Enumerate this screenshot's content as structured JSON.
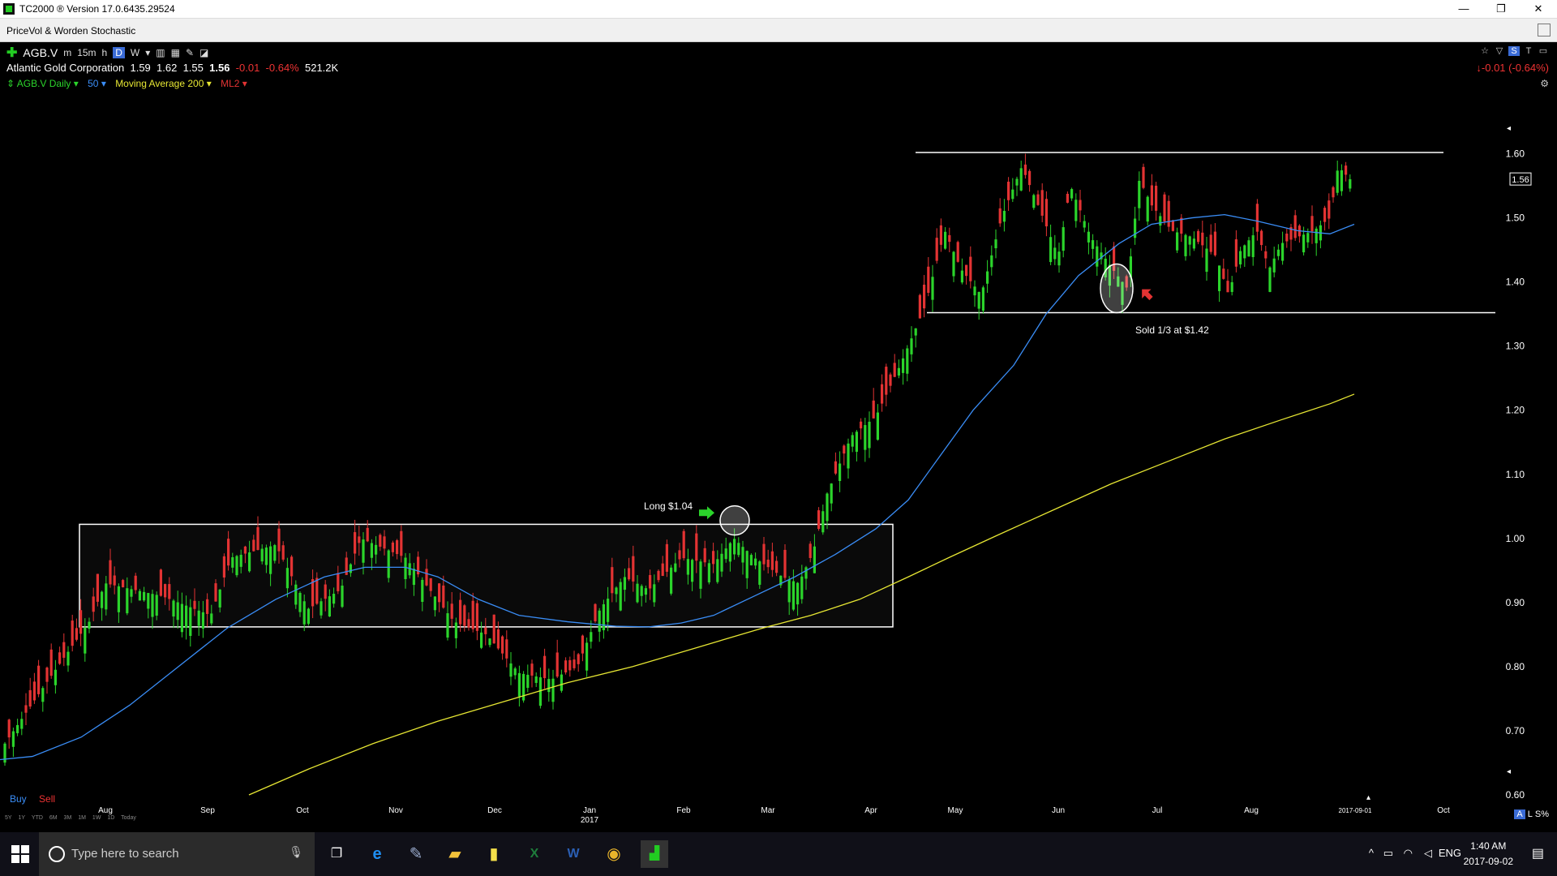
{
  "window": {
    "title": "TC2000 ® Version 17.0.6435.29524",
    "minimize": "—",
    "restore": "❐",
    "close": "✕"
  },
  "subwindow": {
    "title": "PriceVol & Worden Stochastic"
  },
  "header": {
    "symbol": "AGB.V",
    "timeframes": [
      "m",
      "15m",
      "h",
      "D",
      "W"
    ],
    "selected_timeframe": "D",
    "company": "Atlantic Gold Corporation",
    "open": "1.59",
    "high": "1.62",
    "low": "1.55",
    "close": "1.56",
    "change": "-0.01",
    "change_pct": "-0.64%",
    "volume": "521.2K",
    "right_change": "-0.01 (-0.64%)",
    "indicators": [
      {
        "label": "AGB.V Daily",
        "color": "#2bd42b"
      },
      {
        "label": "50",
        "color": "#3a8df6"
      },
      {
        "label": "Moving Average 200",
        "color": "#e6e633"
      },
      {
        "label": "ML2",
        "color": "#e33333"
      }
    ]
  },
  "chart_data": {
    "type": "candlestick",
    "symbol": "AGB.V",
    "y_ticks": [
      "1.60",
      "1.50",
      "1.40",
      "1.30",
      "1.20",
      "1.10",
      "1.00",
      "0.90",
      "0.80",
      "0.70",
      "0.60"
    ],
    "ylim": [
      0.6,
      1.65
    ],
    "x_ticks": [
      "Aug",
      "Sep",
      "Oct",
      "Nov",
      "Dec",
      "Jan",
      "Feb",
      "Mar",
      "Apr",
      "May",
      "Jun",
      "Jul",
      "Aug",
      "2017-09-01",
      "Oct"
    ],
    "year_label": "2017",
    "last_price_label": "1.56",
    "annotations": [
      {
        "text": "Long $1.04"
      },
      {
        "text": "Sold 1/3 at $1.42"
      }
    ],
    "colors": {
      "up": "#2bd42b",
      "down": "#e33333",
      "ma50": "#3a8df6",
      "ma200": "#e6e633",
      "axis_text": "#ffffff",
      "annotation": "#ffffff"
    }
  },
  "footer": {
    "buy": "Buy",
    "sell": "Sell",
    "ranges": [
      "5Y",
      "1Y",
      "YTD",
      "6M",
      "3M",
      "1M",
      "1W",
      "1D",
      "Today"
    ],
    "corner": [
      "A",
      "L",
      "S%"
    ]
  },
  "taskbar": {
    "search_placeholder": "Type here to search",
    "lang": "ENG",
    "time": "1:40 AM",
    "date": "2017-09-02",
    "apps": [
      "task-view-icon",
      "edge-icon",
      "paint-icon",
      "file-explorer-icon",
      "sticky-notes-icon",
      "excel-icon",
      "word-icon",
      "chrome-icon",
      "tc2000-icon"
    ]
  }
}
